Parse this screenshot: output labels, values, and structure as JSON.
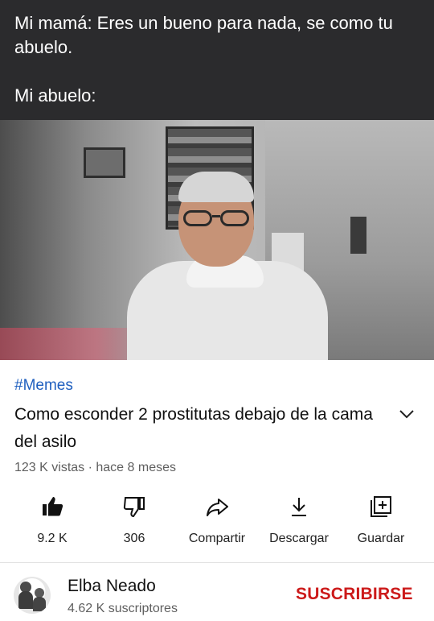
{
  "caption": {
    "line1": "Mi mamá: Eres un bueno para nada, se como tu abuelo.",
    "line2": "Mi abuelo:"
  },
  "video": {
    "hashtag": "#Memes",
    "title": "Como esconder 2 prostitutas debajo de la cama del asilo",
    "meta": "123 K vistas · hace 8 meses"
  },
  "actions": [
    {
      "icon": "thumbs-up-icon",
      "label": "9.2 K"
    },
    {
      "icon": "thumbs-down-icon",
      "label": "306"
    },
    {
      "icon": "share-icon",
      "label": "Compartir"
    },
    {
      "icon": "download-icon",
      "label": "Descargar"
    },
    {
      "icon": "save-playlist-icon",
      "label": "Guardar"
    }
  ],
  "channel": {
    "name": "Elba Neado",
    "subscribers": "4.62 K suscriptores",
    "subscribe_label": "SUSCRIBIRSE"
  },
  "colors": {
    "caption_bg": "#2b2b2d",
    "hashtag": "#1f5fbf",
    "subscribe": "#cc1a1a"
  }
}
